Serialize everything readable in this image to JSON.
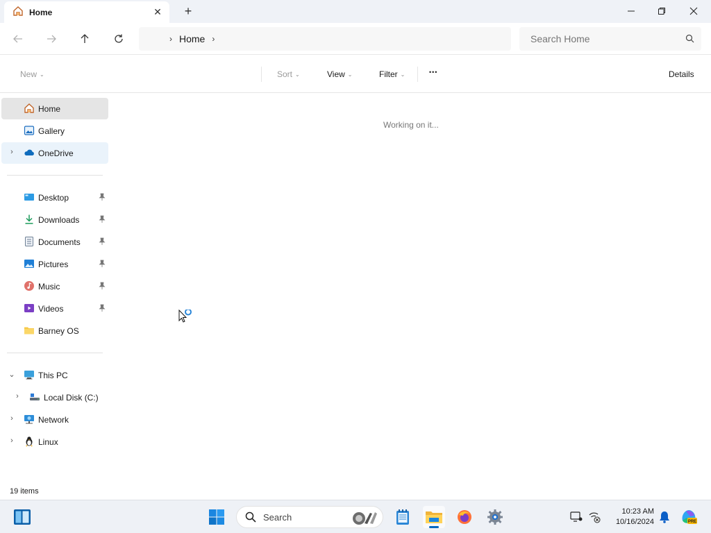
{
  "window": {
    "tab_title": "Home",
    "new_tab_symbol": "+"
  },
  "address_bar": {
    "crumbs": [
      "Home"
    ],
    "search_placeholder": "Search Home"
  },
  "command_bar": {
    "new_label": "New",
    "sort_label": "Sort",
    "view_label": "View",
    "filter_label": "Filter",
    "more_symbol": "•••",
    "details_label": "Details"
  },
  "sidebar": {
    "items": [
      {
        "label": "Home",
        "icon": "home-icon",
        "state": "selected"
      },
      {
        "label": "Gallery",
        "icon": "gallery-icon"
      },
      {
        "label": "OneDrive",
        "icon": "onedrive-icon",
        "state": "hover",
        "expandable": true
      },
      {
        "label": "Desktop",
        "icon": "desktop-icon",
        "pinned": true
      },
      {
        "label": "Downloads",
        "icon": "downloads-icon",
        "pinned": true
      },
      {
        "label": "Documents",
        "icon": "documents-icon",
        "pinned": true
      },
      {
        "label": "Pictures",
        "icon": "pictures-icon",
        "pinned": true
      },
      {
        "label": "Music",
        "icon": "music-icon",
        "pinned": true
      },
      {
        "label": "Videos",
        "icon": "videos-icon",
        "pinned": true
      },
      {
        "label": "Barney OS",
        "icon": "folder-icon"
      },
      {
        "label": "This PC",
        "icon": "pc-icon",
        "expanded": true
      },
      {
        "label": "Local Disk (C:)",
        "icon": "disk-icon",
        "expandable": true
      },
      {
        "label": "Network",
        "icon": "network-icon",
        "expandable": true
      },
      {
        "label": "Linux",
        "icon": "linux-icon",
        "expandable": true
      }
    ]
  },
  "content": {
    "status_message": "Working on it..."
  },
  "status_bar": {
    "item_count": "19 items"
  },
  "taskbar": {
    "search_label": "Search",
    "time": "10:23 AM",
    "date": "10/16/2024",
    "apps": [
      "widgets-icon",
      "start-icon",
      "search-icon",
      "app-icon",
      "notepad-icon",
      "file-explorer-icon",
      "firefox-icon",
      "settings-icon"
    ]
  },
  "colors": {
    "accent": "#0067c0",
    "selected": "#e5e5e5",
    "hover": "#eaf3fb",
    "titlebar": "#eff2f7",
    "taskbar": "#eef1f6"
  }
}
